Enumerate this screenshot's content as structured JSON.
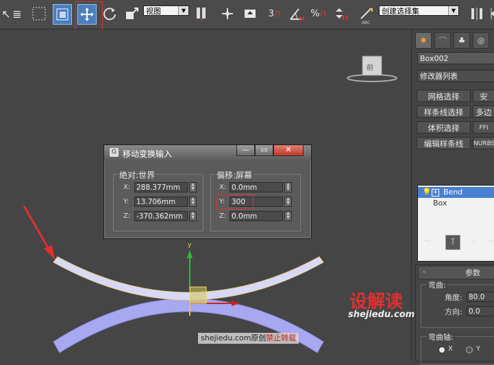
{
  "toolbar": {
    "view_dropdown": "视图",
    "selection_set": "创建选择集",
    "snap_label": "3",
    "percent_label": "%",
    "abc_label": "ABC",
    "items": [
      "select-object",
      "select-by-name",
      "rectangle-region",
      "window-crossing",
      "move",
      "rotate",
      "scale",
      "mirror-view",
      "pivot",
      "select-and-manipulate",
      "snap",
      "angle-snap",
      "percent-snap",
      "spinner-snap",
      "edit-named-sets",
      "mirror"
    ]
  },
  "viewport": {
    "viewcube_label": "前",
    "gizmo_y_label": "y"
  },
  "right_panel": {
    "object_name": "Box002",
    "modifier_list": "修改器列表",
    "modifier_buttons": [
      {
        "label": "网格选择",
        "label2": "安"
      },
      {
        "label": "样条线选择",
        "label2": "多边"
      },
      {
        "label": "体积选择",
        "label2": "FFI"
      },
      {
        "label": "编辑样条线",
        "label2": "NURBS"
      }
    ],
    "stack": [
      {
        "label": "Bend",
        "selected": true
      },
      {
        "label": "Box",
        "selected": false
      }
    ],
    "rollout_minus": "-",
    "rollout_title": "参数",
    "bend_group": "弯曲:",
    "angle_label": "角度:",
    "angle_value": "80.0",
    "direction_label": "方向:",
    "direction_value": "0.0",
    "axis_group": "弯曲轴:",
    "axis_x": "X",
    "axis_y": "Y"
  },
  "dialog": {
    "title": "移动变换输入",
    "absolute_group": "绝对:世界",
    "offset_group": "偏移:屏幕",
    "absolute": [
      {
        "axis": "X:",
        "value": "288.377mm"
      },
      {
        "axis": "Y:",
        "value": "13.706mm"
      },
      {
        "axis": "Z:",
        "value": "-370.362mm"
      }
    ],
    "offset": [
      {
        "axis": "X:",
        "value": "0.0mm"
      },
      {
        "axis": "Y:",
        "value": "300"
      },
      {
        "axis": "Z:",
        "value": "0.0mm"
      }
    ]
  },
  "watermark": {
    "logo_text": "设解读",
    "logo_url": "shejiedu.com",
    "bottom_text": "shejiedu.com原创",
    "bottom_warning": "禁止转载"
  },
  "colors": {
    "highlight_red": "#e03030",
    "active_blue": "#4a7ec0",
    "object_fill": "#a8a8f0",
    "selected_object_fill": "#d8d8f8"
  }
}
